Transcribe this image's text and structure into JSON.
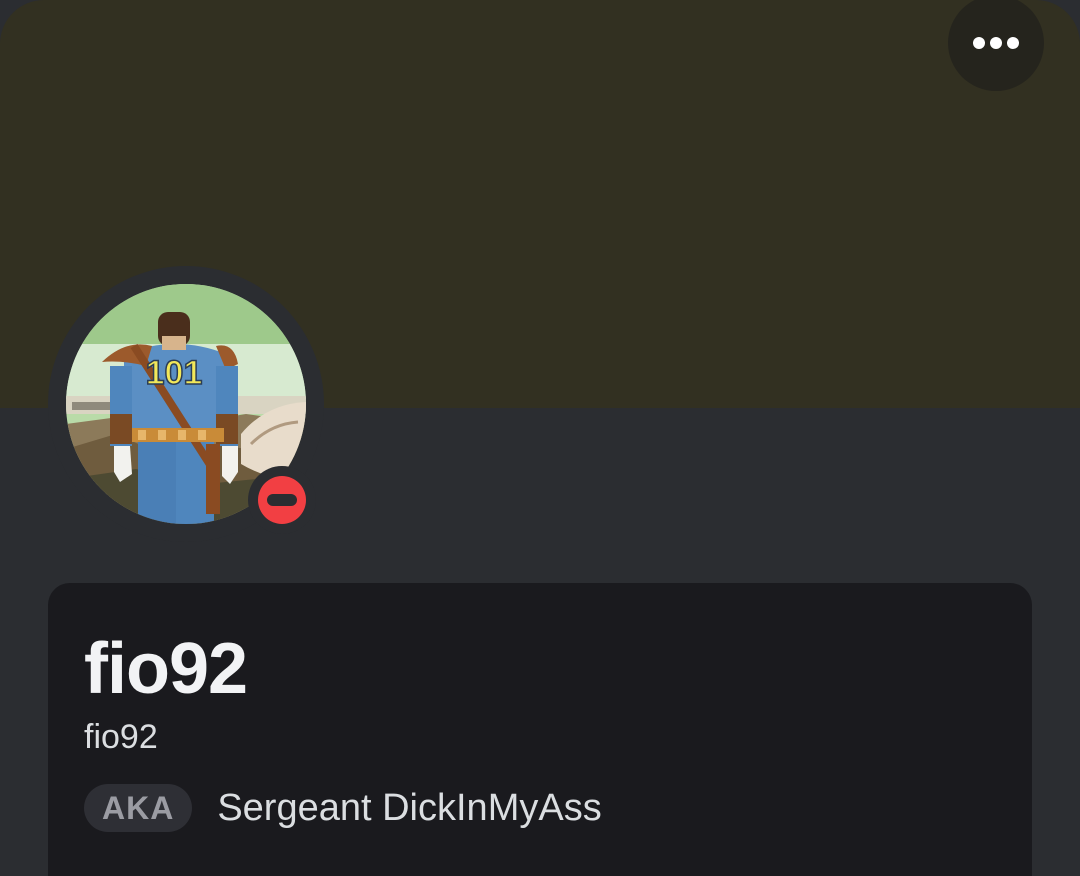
{
  "profile": {
    "display_name": "fio92",
    "username": "fio92",
    "aka_label": "AKA",
    "aka_name": "Sergeant DickInMyAss",
    "status": "do-not-disturb",
    "avatar_jersey_number": "101"
  },
  "header": {
    "more_icon": "more-horizontal-icon"
  },
  "colors": {
    "banner": "#323021",
    "background": "#2b2d31",
    "card": "#1a1a1e",
    "status_dnd": "#f23f43"
  }
}
